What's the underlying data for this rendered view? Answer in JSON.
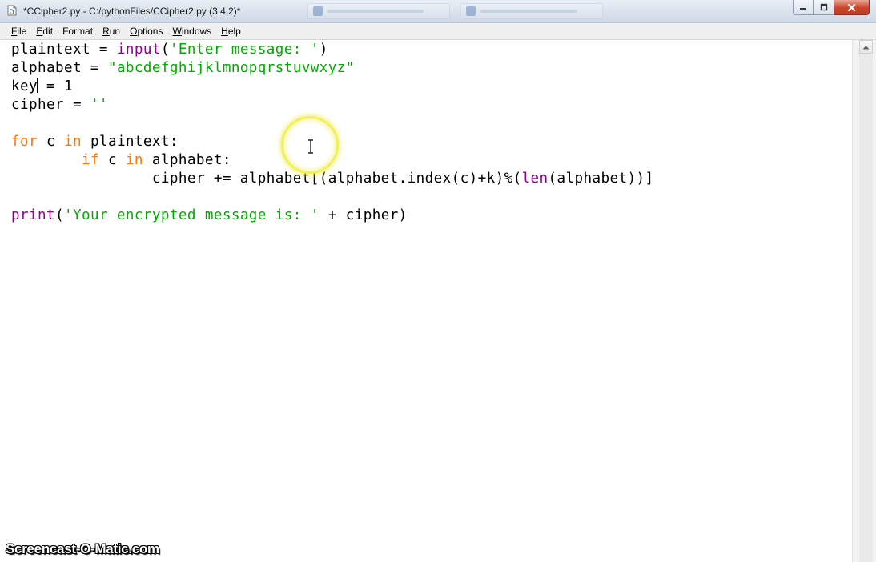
{
  "window": {
    "title": "*CCipher2.py - C:/pythonFiles/CCipher2.py (3.4.2)*",
    "controls": {
      "minimize": "minimize-icon",
      "maximize": "maximize-icon",
      "close": "close-icon"
    }
  },
  "menubar": {
    "items": [
      {
        "key": "F",
        "rest": "ile"
      },
      {
        "key": "E",
        "rest": "dit"
      },
      {
        "key": "",
        "rest": "Format"
      },
      {
        "key": "R",
        "rest": "un"
      },
      {
        "key": "O",
        "rest": "ptions"
      },
      {
        "key": "W",
        "rest": "indows"
      },
      {
        "key": "H",
        "rest": "elp"
      }
    ]
  },
  "editor": {
    "lines": [
      {
        "tokens": [
          {
            "t": "plaintext = ",
            "c": "plain"
          },
          {
            "t": "input",
            "c": "builtin"
          },
          {
            "t": "(",
            "c": "plain"
          },
          {
            "t": "'Enter message: '",
            "c": "string"
          },
          {
            "t": ")",
            "c": "plain"
          }
        ]
      },
      {
        "tokens": [
          {
            "t": "alphabet = ",
            "c": "plain"
          },
          {
            "t": "\"abcdefghijklmnopqrstuvwxyz\"",
            "c": "string"
          }
        ]
      },
      {
        "tokens": [
          {
            "t": "key",
            "c": "plain"
          },
          {
            "t": "",
            "c": "caret"
          },
          {
            "t": " = 1",
            "c": "plain"
          }
        ]
      },
      {
        "tokens": [
          {
            "t": "cipher = ",
            "c": "plain"
          },
          {
            "t": "''",
            "c": "string"
          }
        ]
      },
      {
        "tokens": []
      },
      {
        "tokens": [
          {
            "t": "for",
            "c": "keyword"
          },
          {
            "t": " c ",
            "c": "plain"
          },
          {
            "t": "in",
            "c": "keyword"
          },
          {
            "t": " plaintext:",
            "c": "plain"
          }
        ]
      },
      {
        "tokens": [
          {
            "t": "        ",
            "c": "plain"
          },
          {
            "t": "if",
            "c": "keyword"
          },
          {
            "t": " c ",
            "c": "plain"
          },
          {
            "t": "in",
            "c": "keyword"
          },
          {
            "t": " alphabet:",
            "c": "plain"
          }
        ]
      },
      {
        "tokens": [
          {
            "t": "                cipher += alphabet[(alphabet.index(c)+k)%(",
            "c": "plain"
          },
          {
            "t": "len",
            "c": "builtin"
          },
          {
            "t": "(alphabet))]",
            "c": "plain"
          }
        ]
      },
      {
        "tokens": []
      },
      {
        "tokens": [
          {
            "t": "print",
            "c": "builtin"
          },
          {
            "t": "(",
            "c": "plain"
          },
          {
            "t": "'Your encrypted message is: '",
            "c": "string"
          },
          {
            "t": " + cipher)",
            "c": "plain"
          }
        ]
      }
    ]
  },
  "watermark": {
    "text": "Screencast-O-Matic.com"
  },
  "icons": {
    "app": "python-idle-icon",
    "scroll_up": "scroll-up-arrow-icon",
    "cursor": "ibeam-cursor-icon"
  },
  "colors": {
    "keyword": "#ff7700",
    "builtin": "#900090",
    "string": "#00aa00",
    "cursor_highlight": "#f2f05a"
  }
}
